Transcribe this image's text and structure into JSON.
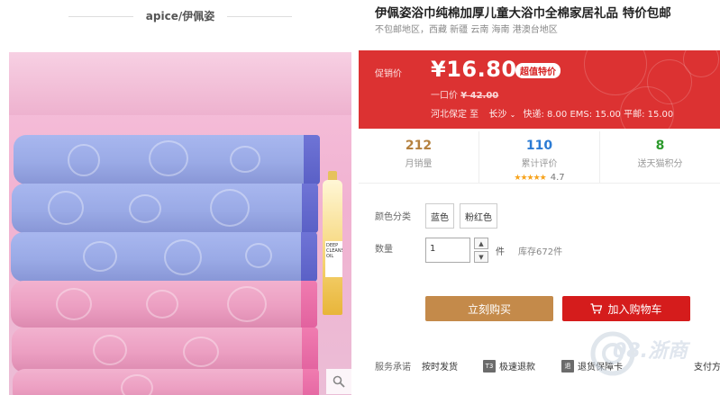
{
  "gallery": {
    "shop_name": "apice/伊佩姿",
    "bottle_label": "DEEP CLEANSING OIL"
  },
  "product": {
    "title": "伊佩姿浴巾纯棉加厚儿童大浴巾全棉家居礼品 特价包邮",
    "subtitle": "不包邮地区，西藏 新疆 云南 海南 港澳台地区"
  },
  "price_box": {
    "label": "促销价",
    "price": "¥16.80",
    "badge": "超值特价",
    "original_label": "一口价",
    "original_price": "¥ 42.00",
    "ship_from": "河北保定 至",
    "ship_to": "长沙",
    "ship_fees": "快递: 8.00 EMS: 15.00 平邮: 15.00",
    "color": "#dc3232"
  },
  "stats": [
    {
      "value": "212",
      "label": "月销量",
      "color": "#b5813f"
    },
    {
      "value": "110",
      "label": "累计评价",
      "color": "#2b7bd4",
      "stars": "★★★★★",
      "rating": "4.7"
    },
    {
      "value": "8",
      "label": "送天猫积分",
      "color": "#2c9a2c"
    }
  ],
  "options": {
    "color_label": "颜色分类",
    "colors": [
      "蓝色",
      "粉红色"
    ],
    "qty_label": "数量",
    "qty_value": "1",
    "qty_up": "▲",
    "qty_down": "▼",
    "qty_unit": "件",
    "stock": "库存672件"
  },
  "actions": {
    "buy_now": "立刻购买",
    "add_cart": "加入购物车"
  },
  "service": {
    "label": "服务承诺",
    "items": [
      {
        "tag": "",
        "text": "按时发货"
      },
      {
        "tag": "T3",
        "text": "极速退款"
      },
      {
        "tag": "退",
        "text": "退货保障卡"
      },
      {
        "tag": "",
        "text": "支付方"
      }
    ]
  },
  "watermark": "08.浙商"
}
